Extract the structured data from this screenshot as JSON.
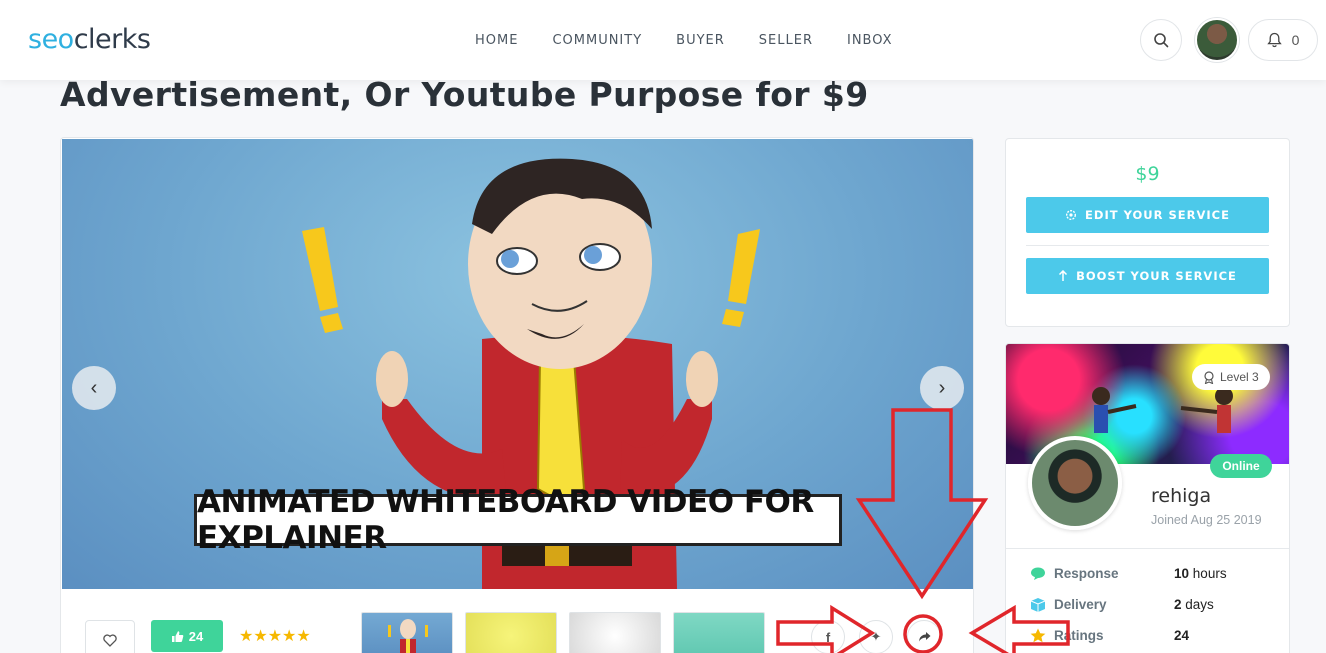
{
  "header": {
    "logo_part1": "seo",
    "logo_part2": "clerks",
    "nav": [
      "HOME",
      "COMMUNITY",
      "BUYER",
      "SELLER",
      "INBOX"
    ],
    "notification_count": "0"
  },
  "page": {
    "title": "Advertisement, Or Youtube Purpose for $9"
  },
  "gallery": {
    "banner_text": "ANIMATED WHITEBOARD VIDEO FOR EXPLAINER",
    "likes": "24",
    "rating_stars": 5
  },
  "sidebar": {
    "price": "$9",
    "edit_label": "EDIT YOUR SERVICE",
    "boost_label": "BOOST YOUR SERVICE"
  },
  "seller": {
    "level": "Level 3",
    "status": "Online",
    "username": "rehiga",
    "joined": "Joined Aug 25 2019",
    "stats": [
      {
        "label": "Response",
        "value_num": "10",
        "value_unit": "hours"
      },
      {
        "label": "Delivery",
        "value_num": "2",
        "value_unit": "days"
      },
      {
        "label": "Ratings",
        "value_num": "24",
        "value_unit": ""
      }
    ]
  },
  "colors": {
    "accent_blue": "#4cc9ea",
    "accent_green": "#3fd49a",
    "annotation_red": "#e0262b"
  }
}
